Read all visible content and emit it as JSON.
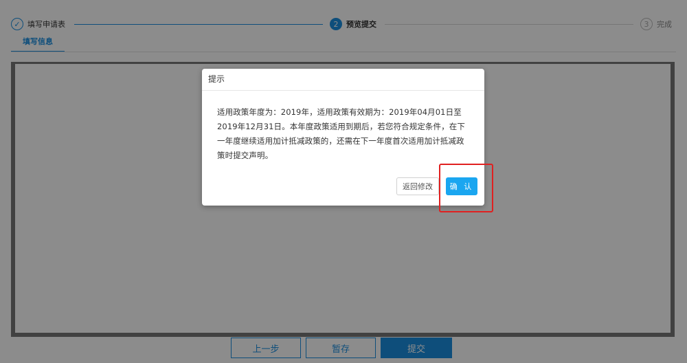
{
  "steps": [
    {
      "index": "✓",
      "label": "填写申请表",
      "state": "done"
    },
    {
      "index": "2",
      "label": "预览提交",
      "state": "active"
    },
    {
      "index": "3",
      "label": "完成",
      "state": "todo"
    }
  ],
  "subtab": {
    "label": "填写信息"
  },
  "actions": {
    "prev": "上一步",
    "save": "暂存",
    "submit": "提交"
  },
  "dialog": {
    "title": "提示",
    "message": "适用政策年度为：2019年，适用政策有效期为：2019年04月01日至2019年12月31日。本年度政策适用到期后，若您符合规定条件，在下一年度继续适用加计抵减政策的，还需在下一年度首次适用加计抵减政策时提交声明。",
    "back_label": "返回修改",
    "confirm_label": "确 认"
  },
  "colors": {
    "primary": "#1a8fe0",
    "confirm": "#1aa6f0",
    "highlight": "#e02020"
  }
}
